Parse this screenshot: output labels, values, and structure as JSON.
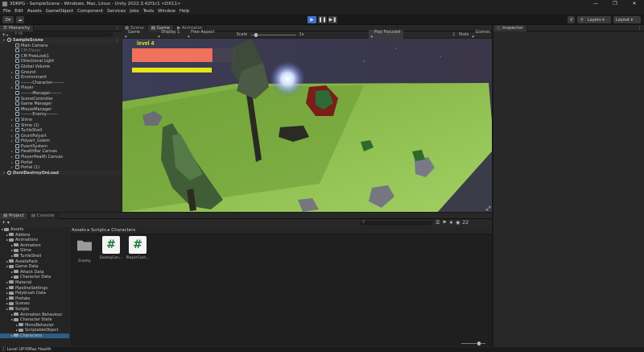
{
  "window": {
    "title": "3DRPG - SampleScene - Windows, Mac, Linux - Unity 2022.3.42f1c1 <DX11>"
  },
  "menu": [
    "File",
    "Edit",
    "Assets",
    "GameObject",
    "Component",
    "Services",
    "Jobs",
    "Tools",
    "Window",
    "Help"
  ],
  "toolbar": {
    "account": "D",
    "layers": "Layers",
    "layout": "Layout"
  },
  "hierarchy": {
    "tab": "Hierarchy",
    "search_placeholder": "All",
    "add": "+",
    "rows": [
      {
        "label": "SampleScene",
        "indent": 0,
        "scene": true
      },
      {
        "label": "Main Camera",
        "indent": 2
      },
      {
        "label": "CM Player",
        "indent": 2,
        "dim": true
      },
      {
        "label": "CM FreeLook1",
        "indent": 2
      },
      {
        "label": "Directional Light",
        "indent": 2
      },
      {
        "label": "Global Volume",
        "indent": 2
      },
      {
        "label": "Ground",
        "indent": 2,
        "tri": true
      },
      {
        "label": "Environment",
        "indent": 2,
        "tri": true
      },
      {
        "label": "--------Character--------",
        "indent": 2
      },
      {
        "label": "Player",
        "indent": 2,
        "tri": true
      },
      {
        "label": "--------Manager--------",
        "indent": 2
      },
      {
        "label": "SceneController",
        "indent": 2
      },
      {
        "label": "Game Manager",
        "indent": 2
      },
      {
        "label": "MouseManager",
        "indent": 2
      },
      {
        "label": "--------Enemy--------",
        "indent": 2
      },
      {
        "label": "Slime",
        "indent": 2,
        "tri": true
      },
      {
        "label": "Slime (1)",
        "indent": 2,
        "tri": true
      },
      {
        "label": "TurtleShell",
        "indent": 2,
        "tri": true
      },
      {
        "label": "GruntPolyart",
        "indent": 2,
        "tri": true
      },
      {
        "label": "Polyart_Golem",
        "indent": 2,
        "tri": true
      },
      {
        "label": "EventSystem",
        "indent": 2
      },
      {
        "label": "HealthBar Canvas",
        "indent": 2,
        "tri": true
      },
      {
        "label": "PlayerHealth Canvas",
        "indent": 2,
        "tri": true
      },
      {
        "label": "Portal",
        "indent": 2,
        "tri": true
      },
      {
        "label": "Portal (1)",
        "indent": 2,
        "tri": true
      },
      {
        "label": "DontDestroyOnLoad",
        "indent": 0,
        "scene": true
      }
    ]
  },
  "game": {
    "tabs": [
      "Scene",
      "Game",
      "Animator"
    ],
    "display_mode": "Game",
    "display": "Display 1",
    "aspect": "Free Aspect",
    "scale_label": "Scale",
    "scale_value": "1x",
    "play_focused": "Play Focused",
    "stats": "Stats",
    "gizmos": "Gizmos",
    "hud": {
      "level_text": "level  4",
      "health_fraction": 0.78,
      "exp_fraction": 0.55,
      "health_color": "#f0715c",
      "exp_color": "#e5e51a"
    }
  },
  "inspector": {
    "tab": "Inspector"
  },
  "project": {
    "tabs": [
      "Project",
      "Console"
    ],
    "breadcrumb": [
      "Assets",
      "Scripts",
      "Characters"
    ],
    "count": "22",
    "tree": [
      {
        "label": "Assets",
        "indent": 0
      },
      {
        "label": "Addons",
        "indent": 1
      },
      {
        "label": "Animations",
        "indent": 1
      },
      {
        "label": "Animators",
        "indent": 2
      },
      {
        "label": "Slime",
        "indent": 2
      },
      {
        "label": "TurtleShell",
        "indent": 2
      },
      {
        "label": "AssetsPack",
        "indent": 1
      },
      {
        "label": "Game Data",
        "indent": 1
      },
      {
        "label": "Attack Data",
        "indent": 2
      },
      {
        "label": "Character Data",
        "indent": 2
      },
      {
        "label": "Material",
        "indent": 1
      },
      {
        "label": "PipelineSettings",
        "indent": 1
      },
      {
        "label": "Polybrush Data",
        "indent": 1
      },
      {
        "label": "Prefabs",
        "indent": 1
      },
      {
        "label": "Scenes",
        "indent": 1
      },
      {
        "label": "Scripts",
        "indent": 1
      },
      {
        "label": "Animation Behaviour",
        "indent": 2
      },
      {
        "label": "Character State",
        "indent": 2
      },
      {
        "label": "MonoBehavior",
        "indent": 3
      },
      {
        "label": "ScriptableObject",
        "indent": 3
      },
      {
        "label": "Characters",
        "indent": 2,
        "selected": true
      }
    ],
    "assets": [
      {
        "label": "Enemy",
        "kind": "folder"
      },
      {
        "label": "EnemyCon...",
        "kind": "script"
      },
      {
        "label": "PlayerCont...",
        "kind": "script"
      }
    ]
  },
  "status": {
    "message": "Level UP!0Max Health"
  },
  "colors": {
    "accent_play": "#3d6fd1",
    "selection": "#2c5d87"
  }
}
